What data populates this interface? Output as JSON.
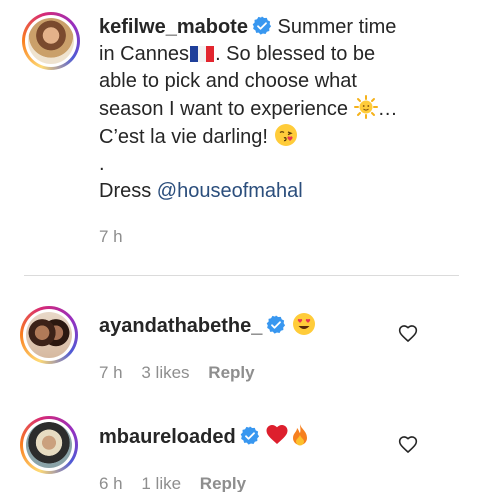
{
  "post": {
    "username": "kefilwe_mabote",
    "caption_line1": "Summer time",
    "caption_line2": "in Cannes",
    "caption_line2b": ". So blessed to be",
    "caption_line3": "able to pick and choose what",
    "caption_line4": "season I want to experience",
    "caption_line4b": "…",
    "caption_line5": "C’est la vie darling!",
    "caption_line6": ".",
    "caption_line7": "Dress",
    "mention": "@houseofmahal",
    "time": "7 h"
  },
  "comments": [
    {
      "username": "ayandathabethe_",
      "time": "7 h",
      "likes": "3 likes",
      "reply": "Reply"
    },
    {
      "username": "mbaureloaded",
      "time": "6 h",
      "likes": "1 like",
      "reply": "Reply"
    }
  ],
  "colors": {
    "verified": "#3897f0",
    "mention": "#2b4e7c",
    "muted": "#8e8e8e"
  },
  "icons": [
    "verified-badge-icon",
    "france-flag-icon",
    "sun-emoji-icon",
    "kiss-emoji-icon",
    "heart-eyes-emoji-icon",
    "red-heart-emoji-icon",
    "fire-emoji-icon",
    "like-heart-icon"
  ]
}
